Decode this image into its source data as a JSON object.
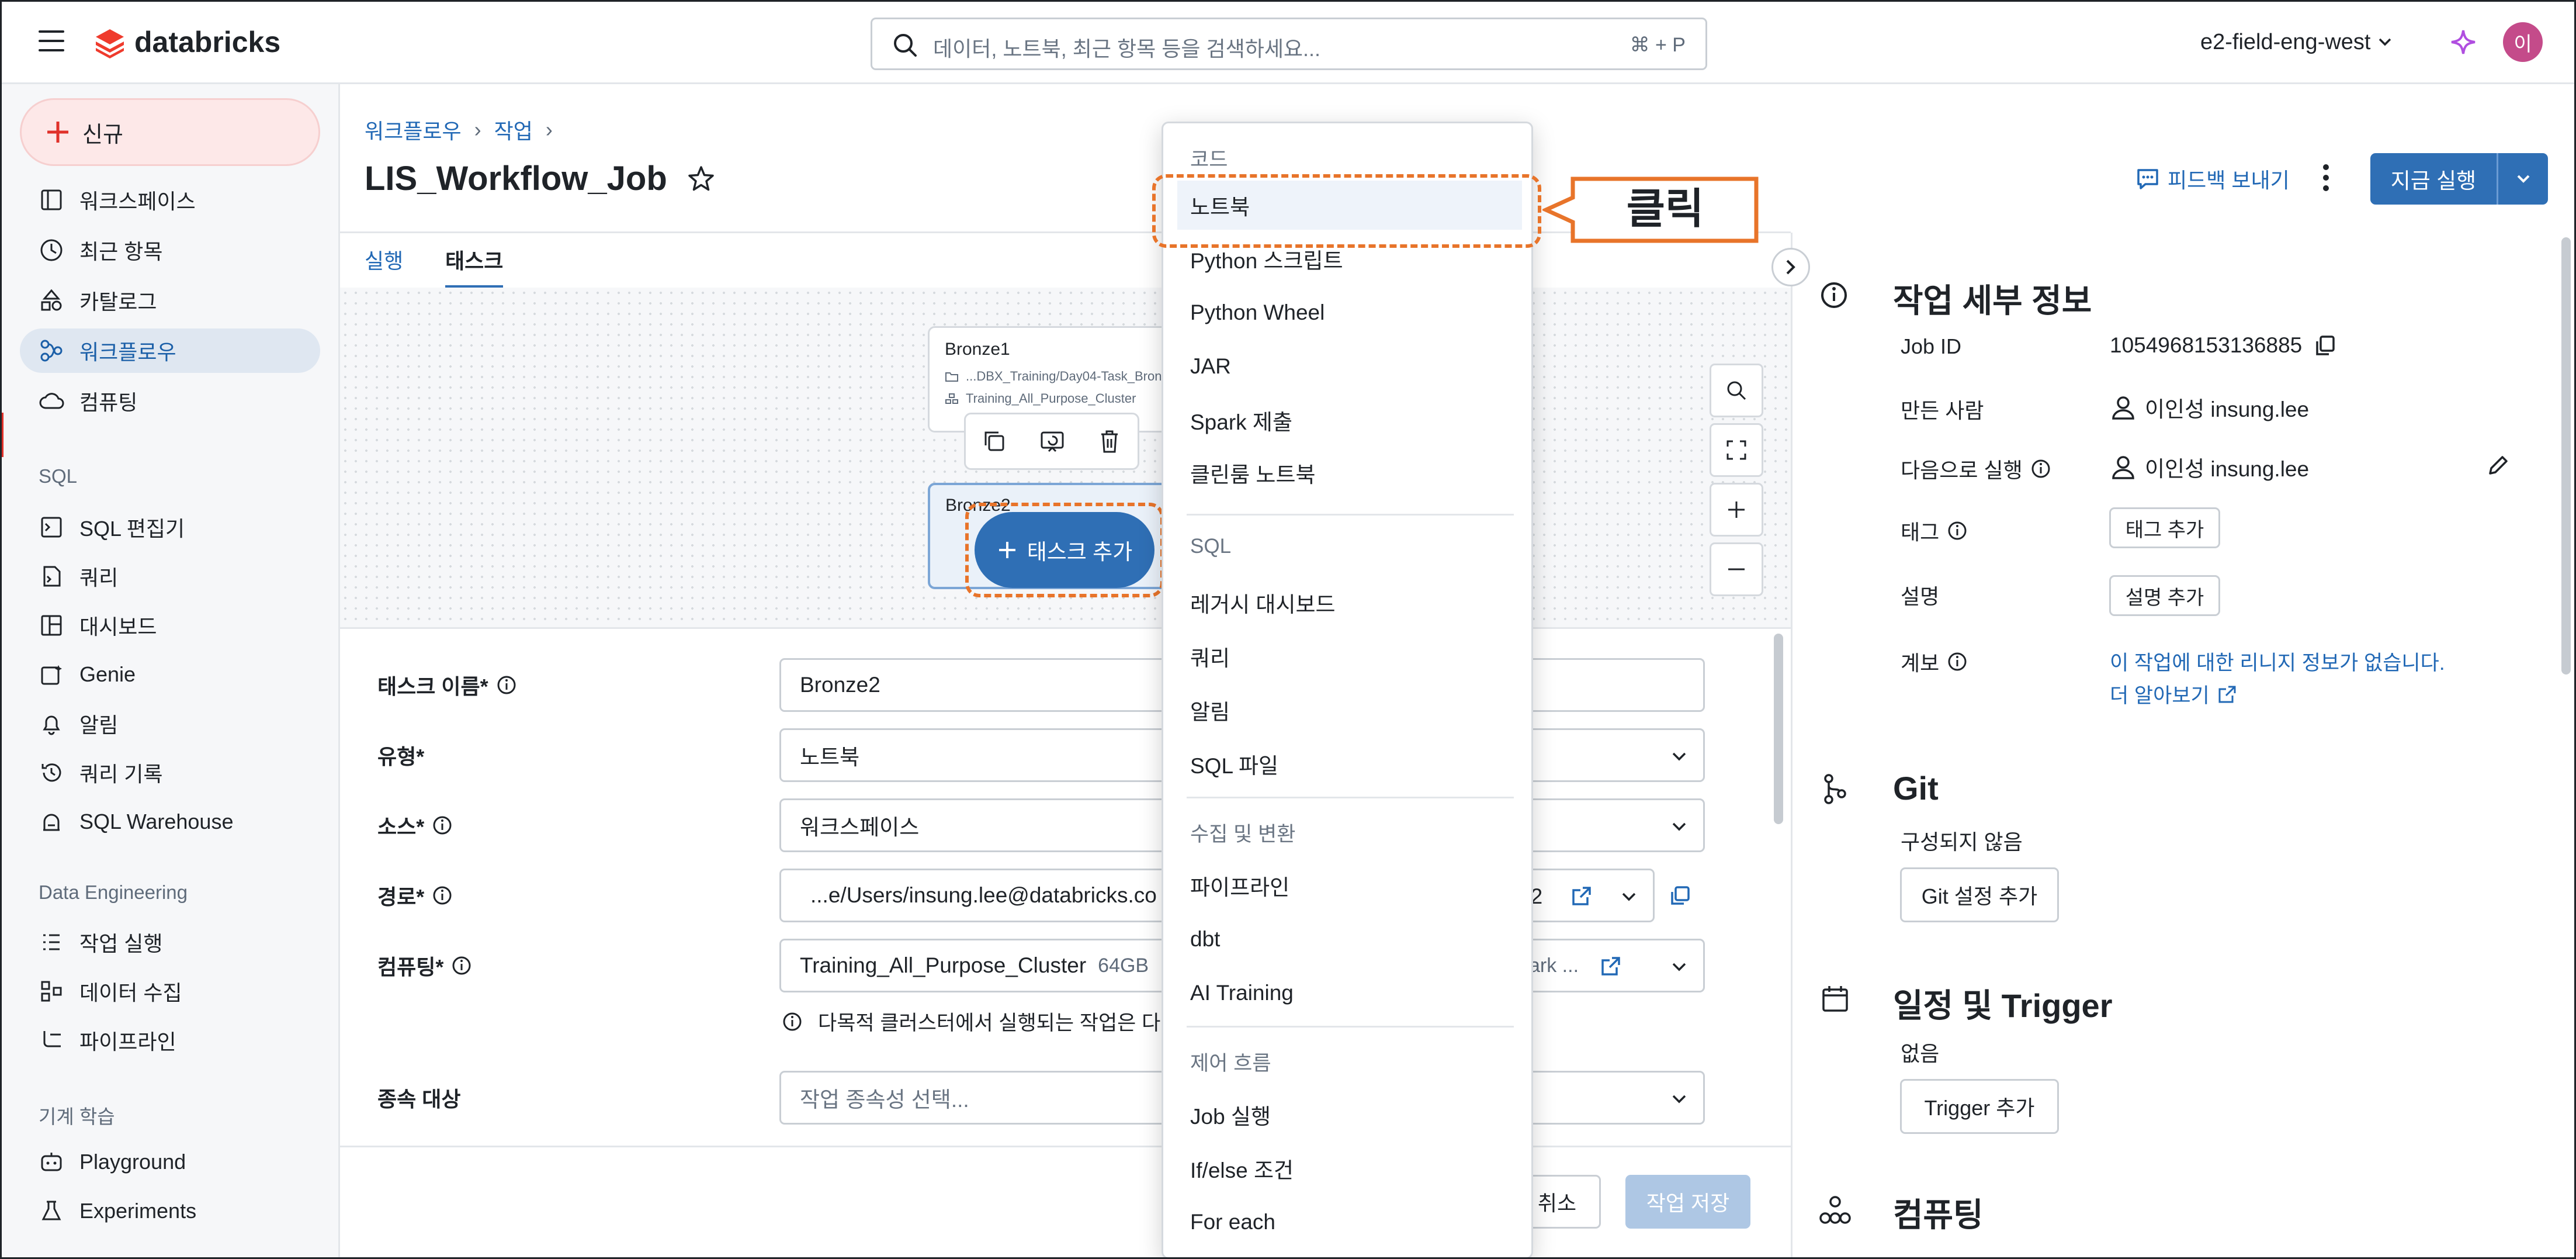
{
  "app": {
    "brand": "databricks",
    "workspace": "e2-field-eng-west",
    "avatar_initial": "이"
  },
  "search": {
    "placeholder": "데이터, 노트북, 최근 항목 등을 검색하세요...",
    "shortcut": "⌘ + P"
  },
  "sidebar": {
    "new_label": "신규",
    "items": [
      {
        "label": "워크스페이스",
        "icon": "folder-icon"
      },
      {
        "label": "최근 항목",
        "icon": "clock-icon"
      },
      {
        "label": "카탈로그",
        "icon": "catalog-icon"
      },
      {
        "label": "워크플로우",
        "icon": "workflow-icon",
        "active": true
      },
      {
        "label": "컴퓨팅",
        "icon": "cloud-icon"
      }
    ],
    "sql_heading": "SQL",
    "sql_items": [
      {
        "label": "SQL 편집기",
        "icon": "sql-editor-icon"
      },
      {
        "label": "쿼리",
        "icon": "query-icon"
      },
      {
        "label": "대시보드",
        "icon": "dashboard-icon"
      },
      {
        "label": "Genie",
        "icon": "genie-icon"
      },
      {
        "label": "알림",
        "icon": "bell-icon"
      },
      {
        "label": "쿼리 기록",
        "icon": "history-icon"
      },
      {
        "label": "SQL Warehouse",
        "icon": "warehouse-icon"
      }
    ],
    "de_heading": "Data Engineering",
    "de_items": [
      {
        "label": "작업 실행",
        "icon": "job-runs-icon"
      },
      {
        "label": "데이터 수집",
        "icon": "ingest-icon"
      },
      {
        "label": "파이프라인",
        "icon": "pipeline-icon"
      }
    ],
    "ml_heading": "기계 학습",
    "ml_items": [
      {
        "label": "Playground",
        "icon": "playground-icon"
      },
      {
        "label": "Experiments",
        "icon": "experiments-icon"
      }
    ]
  },
  "breadcrumb": {
    "item1": "워크플로우",
    "item2": "작업",
    "sep": "›"
  },
  "job": {
    "title": "LIS_Workflow_Job"
  },
  "header_actions": {
    "feedback": "피드백 보내기",
    "run_now": "지금 실행"
  },
  "tabs": {
    "runs": "실행",
    "tasks": "태스크"
  },
  "dag": {
    "node1": {
      "name": "Bronze1",
      "path": "...DBX_Training/Day04-Task_Bron",
      "cluster": "Training_All_Purpose_Cluster"
    },
    "node2": {
      "name": "Bronze2"
    },
    "add_task": "태스크 추가"
  },
  "form": {
    "task_name_label": "태스크 이름*",
    "task_name_value": "Bronze2",
    "type_label": "유형*",
    "type_value": "노트북",
    "source_label": "소스*",
    "source_value": "워크스페이스",
    "path_label": "경로*",
    "path_value": "...e/Users/insung.lee@databricks.co",
    "path_suffix": "e2",
    "compute_label": "컴퓨팅*",
    "compute_value": "Training_All_Purpose_Cluster",
    "compute_meta": "64GB",
    "compute_suffix": "ark ...",
    "compute_note": "다목적 클러스터에서 실행되는 작업은 다",
    "depends_label": "종속 대상",
    "depends_placeholder": "작업 종속성 선택...",
    "cancel": "취소",
    "save": "작업 저장"
  },
  "menu": {
    "code_heading": "코드",
    "code_items": [
      "노트북",
      "Python 스크립트",
      "Python Wheel",
      "JAR",
      "Spark 제출",
      "클린룸 노트북"
    ],
    "sql_heading": "SQL",
    "sql_items": [
      "레거시 대시보드",
      "쿼리",
      "알림",
      "SQL 파일"
    ],
    "ingest_heading": "수집 및 변환",
    "ingest_items": [
      "파이프라인",
      "dbt",
      "AI Training"
    ],
    "flow_heading": "제어 흐름",
    "flow_items": [
      "Job 실행",
      "If/else 조건",
      "For each"
    ]
  },
  "callout": {
    "text": "클릭",
    "color": "#e8742a"
  },
  "details": {
    "heading": "작업 세부 정보",
    "job_id_label": "Job ID",
    "job_id": "1054968153136885",
    "creator_label": "만든 사람",
    "creator": "이인성 insung.lee",
    "run_as_label": "다음으로 실행",
    "run_as": "이인성 insung.lee",
    "tags_label": "태그",
    "tags_button": "태그 추가",
    "desc_label": "설명",
    "desc_button": "설명 추가",
    "lineage_label": "계보",
    "lineage_text": "이 작업에 대한 리니지 정보가 없습니다.",
    "lineage_link": "더 알아보기"
  },
  "git": {
    "heading": "Git",
    "status": "구성되지 않음",
    "button": "Git 설정 추가"
  },
  "schedule": {
    "heading": "일정 및 Trigger",
    "status": "없음",
    "button": "Trigger 추가"
  },
  "compute_section": {
    "heading": "컴퓨팅"
  },
  "colors": {
    "primary": "#2f6fb5",
    "accent": "#e8742a",
    "sidebar_active": "#dfe7f1",
    "new_button": "#fde8e8"
  }
}
